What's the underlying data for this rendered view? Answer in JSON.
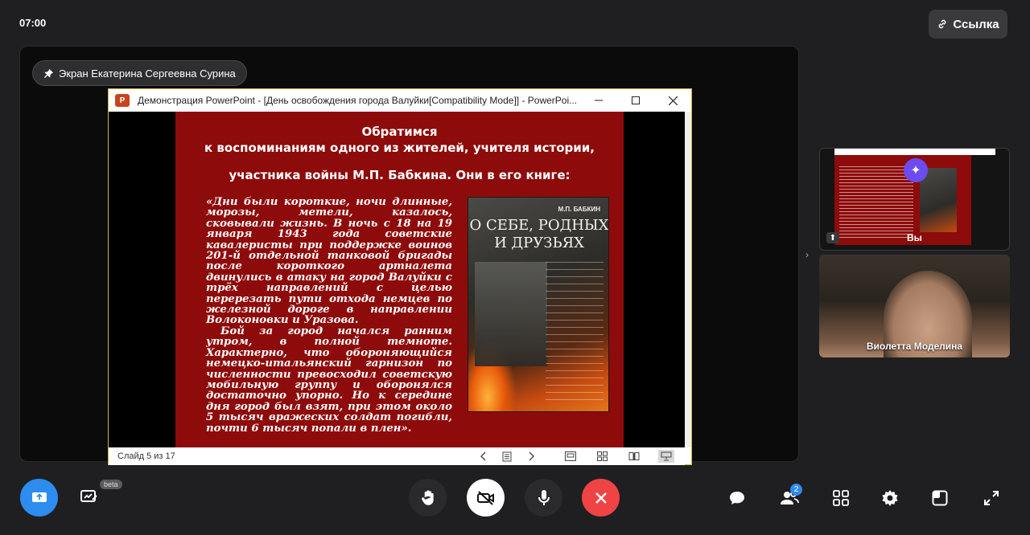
{
  "header": {
    "timer": "07:00",
    "link_button": "Ссылка"
  },
  "stage": {
    "pinned_label": "Экран Екатерина Сергеевна Сурина"
  },
  "ppt": {
    "window_title": "Демонстрация PowerPoint - [День освобождения города Валуйки[Compatibility Mode]] - PowerPoi...",
    "status_text": "Слайд 5 из 17",
    "slide": {
      "title_line1": "Обратимся",
      "title_line2": "к воспоминаниям одного из  жителей, учителя истории,",
      "title_line3": "участника войны М.П. Бабкина. Они в его книге:",
      "paragraph1": "«Дни были короткие, ночи длинные, морозы, метели, казалось, сковывали жизнь. В ночь с 18 на 19 января 1943 года советские кавалеристы при поддержке воинов 201-й отдельной танковой бригады после короткого артналета двинулись в атаку на город Валуйки с трёх направлений с целью перерезать пути отхода немцев по железной дороге в направлении Волоконовки и Уразова.",
      "paragraph2": "Бой за город начался ранним утром, в полной темноте. Характерно, что обороняющийся немецко-итальянский гарнизон по численности превосходил советскую мобильную группу и оборонялся достаточно упорно. Но к середине дня город был взят, при этом около 5 тысяч вражеских солдат погибли, почти 6 тысяч попали в плен».",
      "book_author": "М.П. БАБКИН",
      "book_title": "О СЕБЕ, РОДНЫХ И ДРУЗЬЯХ"
    }
  },
  "participants": [
    {
      "name": "Вы"
    },
    {
      "name": "Виолетта Моделина"
    }
  ],
  "controls": {
    "board_badge": "beta",
    "people_count": "2"
  },
  "colors": {
    "accent": "#2d8cf0",
    "hangup": "#f04444",
    "slide_bg": "#8e0b0b",
    "ppt_border": "#d6b24a"
  }
}
